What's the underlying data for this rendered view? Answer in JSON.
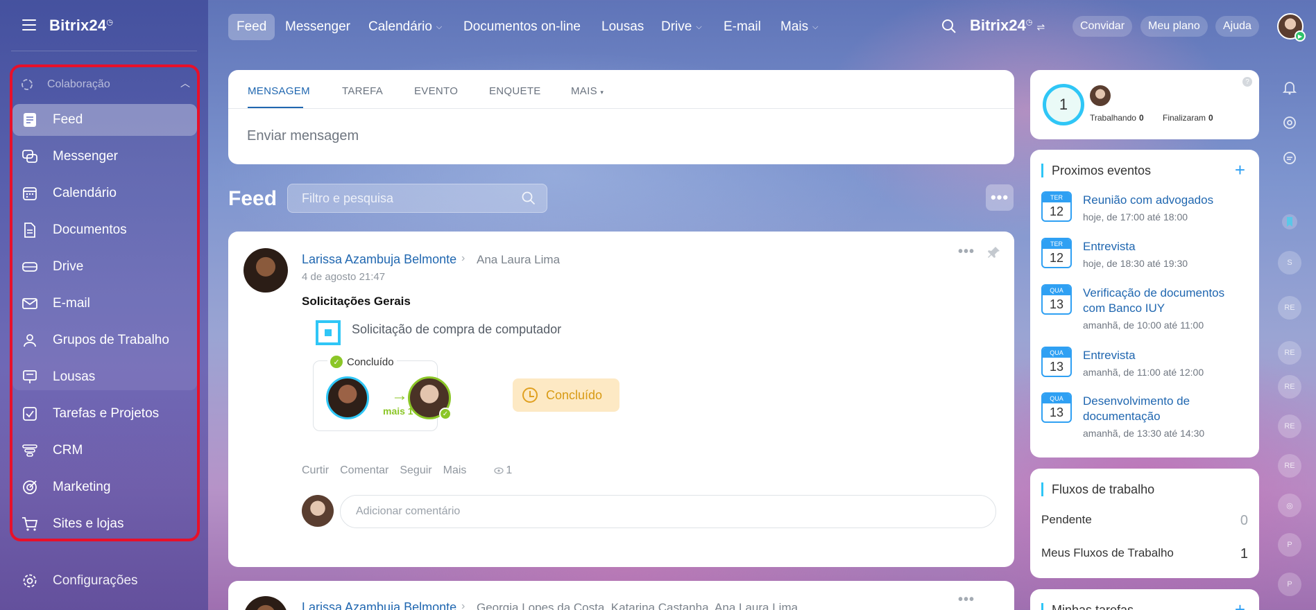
{
  "sidebar": {
    "brand": "Bitrix24",
    "group_label": "Colaboração",
    "items": [
      {
        "label": "Feed"
      },
      {
        "label": "Messenger"
      },
      {
        "label": "Calendário"
      },
      {
        "label": "Documentos"
      },
      {
        "label": "Drive"
      },
      {
        "label": "E-mail"
      },
      {
        "label": "Grupos de Trabalho"
      },
      {
        "label": "Lousas"
      },
      {
        "label": "Tarefas e Projetos"
      },
      {
        "label": "CRM"
      },
      {
        "label": "Marketing"
      },
      {
        "label": "Sites e lojas"
      }
    ],
    "settings_label": "Configurações",
    "highlight_color": "#e8102a"
  },
  "topbar": {
    "nav": [
      {
        "label": "Feed"
      },
      {
        "label": "Messenger"
      },
      {
        "label": "Calendário"
      },
      {
        "label": "Documentos on-line"
      },
      {
        "label": "Lousas"
      },
      {
        "label": "Drive"
      },
      {
        "label": "E-mail"
      },
      {
        "label": "Mais"
      }
    ],
    "brand": "Bitrix24",
    "invite": "Convidar",
    "plan": "Meu plano",
    "help": "Ajuda"
  },
  "composer": {
    "tabs": [
      "MENSAGEM",
      "TAREFA",
      "EVENTO",
      "ENQUETE",
      "MAIS"
    ],
    "placeholder": "Enviar mensagem"
  },
  "feed": {
    "title": "Feed",
    "filter_placeholder": "Filtro e pesquisa"
  },
  "post": {
    "author": "Larissa Azambuja Belmonte",
    "recipient": "Ana Laura Lima",
    "date": "4 de agosto 21:47",
    "title": "Solicitações Gerais",
    "request": "Solicitação de compra de computador",
    "flow_status": "Concluído",
    "flow_more": "mais 1",
    "status_badge": "Concluído",
    "actions": [
      "Curtir",
      "Comentar",
      "Seguir",
      "Mais"
    ],
    "views": "1",
    "comment_placeholder": "Adicionar comentário"
  },
  "post2": {
    "author": "Larissa Azambuja Belmonte",
    "recipients": "Georgia Lopes da Costa, Katarina Castanha, Ana Laura Lima"
  },
  "status_widget": {
    "count": "1",
    "working_label": "Trabalhando",
    "working_value": "0",
    "finished_label": "Finalizaram",
    "finished_value": "0"
  },
  "events": {
    "title": "Proximos eventos",
    "items": [
      {
        "dow": "TER",
        "day": "12",
        "title": "Reunião com advogados",
        "time": "hoje, de 17:00 até 18:00"
      },
      {
        "dow": "TER",
        "day": "12",
        "title": "Entrevista",
        "time": "hoje, de 18:30 até 19:30"
      },
      {
        "dow": "QUA",
        "day": "13",
        "title": "Verificação de documentos com Banco IUY",
        "time": "amanhã, de 10:00 até 11:00"
      },
      {
        "dow": "QUA",
        "day": "13",
        "title": "Entrevista",
        "time": "amanhã, de 11:00 até 12:00"
      },
      {
        "dow": "QUA",
        "day": "13",
        "title": "Desenvolvimento de documentação",
        "time": "amanhã, de 13:30 até 14:30"
      }
    ]
  },
  "workflows": {
    "title": "Fluxos de trabalho",
    "rows": [
      {
        "label": "Pendente",
        "value": "0"
      },
      {
        "label": "Meus Fluxos de Trabalho",
        "value": "1"
      }
    ]
  },
  "tasks": {
    "title": "Minhas tarefas"
  },
  "rail": {
    "badges": [
      "S",
      "RE",
      "RE",
      "RE",
      "RE",
      "RE",
      "P",
      "P"
    ]
  }
}
